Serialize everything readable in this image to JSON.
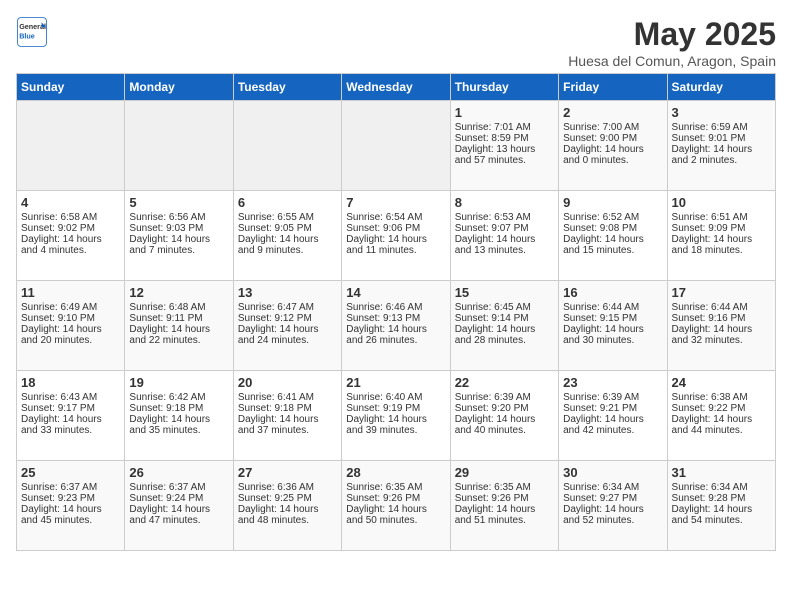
{
  "header": {
    "logo_general": "General",
    "logo_blue": "Blue",
    "month_title": "May 2025",
    "location": "Huesa del Comun, Aragon, Spain"
  },
  "days_of_week": [
    "Sunday",
    "Monday",
    "Tuesday",
    "Wednesday",
    "Thursday",
    "Friday",
    "Saturday"
  ],
  "weeks": [
    [
      {
        "day": "",
        "data": ""
      },
      {
        "day": "",
        "data": ""
      },
      {
        "day": "",
        "data": ""
      },
      {
        "day": "",
        "data": ""
      },
      {
        "day": "1",
        "sunrise": "Sunrise: 7:01 AM",
        "sunset": "Sunset: 8:59 PM",
        "daylight": "Daylight: 13 hours and 57 minutes."
      },
      {
        "day": "2",
        "sunrise": "Sunrise: 7:00 AM",
        "sunset": "Sunset: 9:00 PM",
        "daylight": "Daylight: 14 hours and 0 minutes."
      },
      {
        "day": "3",
        "sunrise": "Sunrise: 6:59 AM",
        "sunset": "Sunset: 9:01 PM",
        "daylight": "Daylight: 14 hours and 2 minutes."
      }
    ],
    [
      {
        "day": "4",
        "sunrise": "Sunrise: 6:58 AM",
        "sunset": "Sunset: 9:02 PM",
        "daylight": "Daylight: 14 hours and 4 minutes."
      },
      {
        "day": "5",
        "sunrise": "Sunrise: 6:56 AM",
        "sunset": "Sunset: 9:03 PM",
        "daylight": "Daylight: 14 hours and 7 minutes."
      },
      {
        "day": "6",
        "sunrise": "Sunrise: 6:55 AM",
        "sunset": "Sunset: 9:05 PM",
        "daylight": "Daylight: 14 hours and 9 minutes."
      },
      {
        "day": "7",
        "sunrise": "Sunrise: 6:54 AM",
        "sunset": "Sunset: 9:06 PM",
        "daylight": "Daylight: 14 hours and 11 minutes."
      },
      {
        "day": "8",
        "sunrise": "Sunrise: 6:53 AM",
        "sunset": "Sunset: 9:07 PM",
        "daylight": "Daylight: 14 hours and 13 minutes."
      },
      {
        "day": "9",
        "sunrise": "Sunrise: 6:52 AM",
        "sunset": "Sunset: 9:08 PM",
        "daylight": "Daylight: 14 hours and 15 minutes."
      },
      {
        "day": "10",
        "sunrise": "Sunrise: 6:51 AM",
        "sunset": "Sunset: 9:09 PM",
        "daylight": "Daylight: 14 hours and 18 minutes."
      }
    ],
    [
      {
        "day": "11",
        "sunrise": "Sunrise: 6:49 AM",
        "sunset": "Sunset: 9:10 PM",
        "daylight": "Daylight: 14 hours and 20 minutes."
      },
      {
        "day": "12",
        "sunrise": "Sunrise: 6:48 AM",
        "sunset": "Sunset: 9:11 PM",
        "daylight": "Daylight: 14 hours and 22 minutes."
      },
      {
        "day": "13",
        "sunrise": "Sunrise: 6:47 AM",
        "sunset": "Sunset: 9:12 PM",
        "daylight": "Daylight: 14 hours and 24 minutes."
      },
      {
        "day": "14",
        "sunrise": "Sunrise: 6:46 AM",
        "sunset": "Sunset: 9:13 PM",
        "daylight": "Daylight: 14 hours and 26 minutes."
      },
      {
        "day": "15",
        "sunrise": "Sunrise: 6:45 AM",
        "sunset": "Sunset: 9:14 PM",
        "daylight": "Daylight: 14 hours and 28 minutes."
      },
      {
        "day": "16",
        "sunrise": "Sunrise: 6:44 AM",
        "sunset": "Sunset: 9:15 PM",
        "daylight": "Daylight: 14 hours and 30 minutes."
      },
      {
        "day": "17",
        "sunrise": "Sunrise: 6:44 AM",
        "sunset": "Sunset: 9:16 PM",
        "daylight": "Daylight: 14 hours and 32 minutes."
      }
    ],
    [
      {
        "day": "18",
        "sunrise": "Sunrise: 6:43 AM",
        "sunset": "Sunset: 9:17 PM",
        "daylight": "Daylight: 14 hours and 33 minutes."
      },
      {
        "day": "19",
        "sunrise": "Sunrise: 6:42 AM",
        "sunset": "Sunset: 9:18 PM",
        "daylight": "Daylight: 14 hours and 35 minutes."
      },
      {
        "day": "20",
        "sunrise": "Sunrise: 6:41 AM",
        "sunset": "Sunset: 9:18 PM",
        "daylight": "Daylight: 14 hours and 37 minutes."
      },
      {
        "day": "21",
        "sunrise": "Sunrise: 6:40 AM",
        "sunset": "Sunset: 9:19 PM",
        "daylight": "Daylight: 14 hours and 39 minutes."
      },
      {
        "day": "22",
        "sunrise": "Sunrise: 6:39 AM",
        "sunset": "Sunset: 9:20 PM",
        "daylight": "Daylight: 14 hours and 40 minutes."
      },
      {
        "day": "23",
        "sunrise": "Sunrise: 6:39 AM",
        "sunset": "Sunset: 9:21 PM",
        "daylight": "Daylight: 14 hours and 42 minutes."
      },
      {
        "day": "24",
        "sunrise": "Sunrise: 6:38 AM",
        "sunset": "Sunset: 9:22 PM",
        "daylight": "Daylight: 14 hours and 44 minutes."
      }
    ],
    [
      {
        "day": "25",
        "sunrise": "Sunrise: 6:37 AM",
        "sunset": "Sunset: 9:23 PM",
        "daylight": "Daylight: 14 hours and 45 minutes."
      },
      {
        "day": "26",
        "sunrise": "Sunrise: 6:37 AM",
        "sunset": "Sunset: 9:24 PM",
        "daylight": "Daylight: 14 hours and 47 minutes."
      },
      {
        "day": "27",
        "sunrise": "Sunrise: 6:36 AM",
        "sunset": "Sunset: 9:25 PM",
        "daylight": "Daylight: 14 hours and 48 minutes."
      },
      {
        "day": "28",
        "sunrise": "Sunrise: 6:35 AM",
        "sunset": "Sunset: 9:26 PM",
        "daylight": "Daylight: 14 hours and 50 minutes."
      },
      {
        "day": "29",
        "sunrise": "Sunrise: 6:35 AM",
        "sunset": "Sunset: 9:26 PM",
        "daylight": "Daylight: 14 hours and 51 minutes."
      },
      {
        "day": "30",
        "sunrise": "Sunrise: 6:34 AM",
        "sunset": "Sunset: 9:27 PM",
        "daylight": "Daylight: 14 hours and 52 minutes."
      },
      {
        "day": "31",
        "sunrise": "Sunrise: 6:34 AM",
        "sunset": "Sunset: 9:28 PM",
        "daylight": "Daylight: 14 hours and 54 minutes."
      }
    ]
  ]
}
